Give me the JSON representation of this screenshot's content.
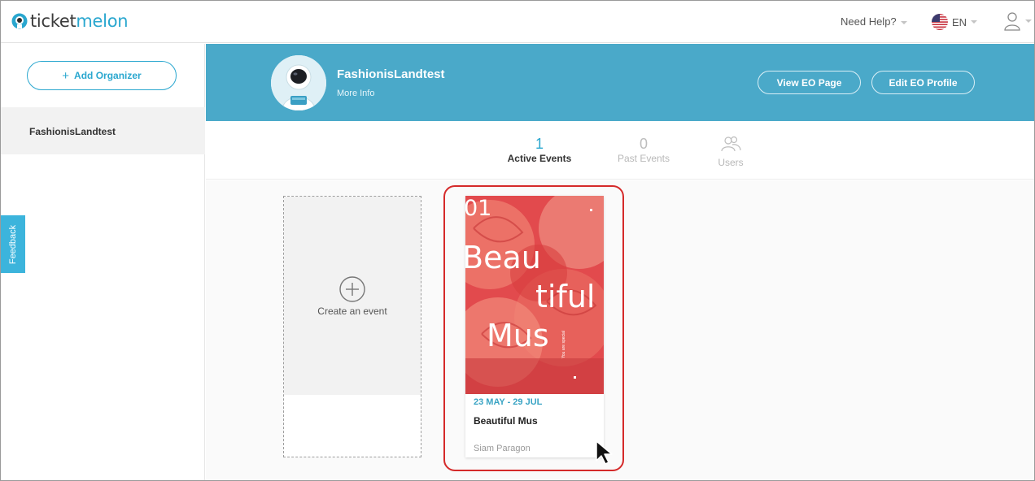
{
  "header": {
    "logo": {
      "prefix": "ticket",
      "suffix": "melon"
    },
    "need_help": "Need Help?",
    "language": "EN"
  },
  "sidebar": {
    "add_organizer": "Add Organizer",
    "organizers": [
      {
        "name": "FashionisLandtest"
      }
    ],
    "feedback": "Feedback"
  },
  "banner": {
    "org_name": "FashionisLandtest",
    "more_info": "More Info",
    "view_page": "View EO Page",
    "edit_profile": "Edit EO Profile"
  },
  "tabs": {
    "active": {
      "count": "1",
      "label": "Active Events"
    },
    "past": {
      "count": "0",
      "label": "Past Events"
    },
    "users": {
      "label": "Users"
    }
  },
  "create_card": {
    "label": "Create an event"
  },
  "event": {
    "poster_text": {
      "number": "01",
      "line1": "Beau",
      "line2": "tiful",
      "line3": "Mus",
      "tagline": "You are special"
    },
    "date": "23 MAY - 29 JUL",
    "title": "Beautiful Mus",
    "venue": "Siam Paragon"
  },
  "colors": {
    "accent": "#2aa7cf",
    "banner": "#4aa9c9",
    "highlight": "#d52a2a",
    "poster": "#e34d4f"
  }
}
